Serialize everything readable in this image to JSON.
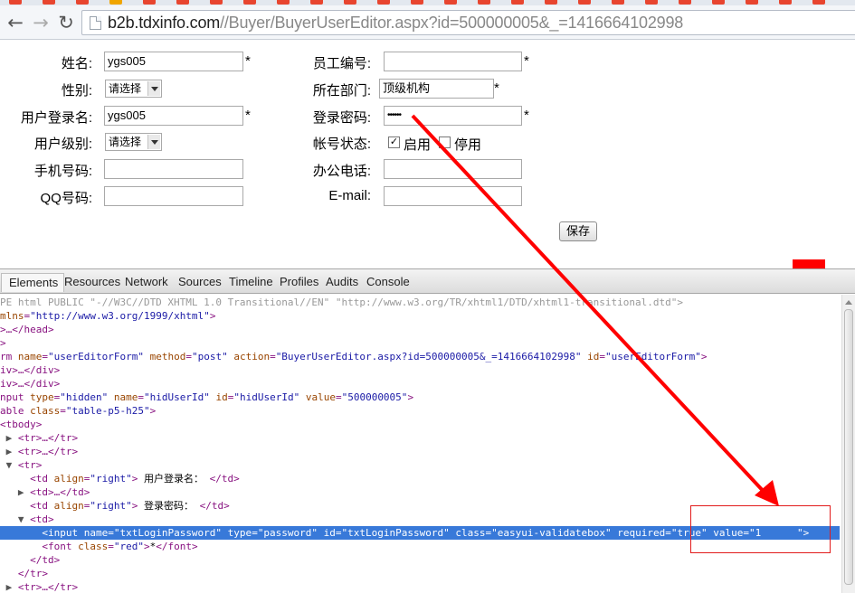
{
  "browser": {
    "url_domain": "b2b.tdxinfo.com",
    "url_path": "//Buyer/BuyerUserEditor.aspx?id=500000005&_=1416664102998",
    "back_icon": "back-arrow-icon",
    "forward_icon": "forward-arrow-icon",
    "reload_icon": "reload-icon",
    "tab_colors": [
      "#e8452f",
      "#e8452f",
      "#e8452f",
      "#f0a500",
      "#e8452f",
      "#e8452f",
      "#e8452f",
      "#e8452f",
      "#e8452f",
      "#e8452f",
      "#e8452f",
      "#e8452f",
      "#e8452f",
      "#e8452f",
      "#e8452f",
      "#e8452f",
      "#e8452f",
      "#e8452f",
      "#e8452f",
      "#e8452f",
      "#e8452f",
      "#e8452f",
      "#e8452f",
      "#e8452f",
      "#e8452f"
    ]
  },
  "form": {
    "name_label": "姓名:",
    "name_value": "ygs005",
    "employee_no_label": "员工编号:",
    "employee_no_value": "",
    "gender_label": "性别:",
    "gender_value": "请选择",
    "department_label": "所在部门:",
    "department_value": "顶级机构",
    "login_name_label": "用户登录名:",
    "login_name_value": "ygs005",
    "password_label": "登录密码:",
    "password_value": "••••••",
    "user_level_label": "用户级别:",
    "user_level_value": "请选择",
    "account_status_label": "帐号状态:",
    "enabled_label": "启用",
    "enabled_checked": true,
    "disabled_label": "停用",
    "disabled_checked": false,
    "mobile_label": "手机号码:",
    "mobile_value": "",
    "office_phone_label": "办公电话:",
    "office_phone_value": "",
    "qq_label": "QQ号码:",
    "qq_value": "",
    "email_label": "E-mail:",
    "email_value": "",
    "required_mark": "*",
    "save_label": "保存"
  },
  "devtools": {
    "tabs": [
      "Elements",
      "Resources",
      "Network",
      "Sources",
      "Timeline",
      "Profiles",
      "Audits",
      "Console"
    ],
    "active_tab": "Elements",
    "selected_line_index": 17,
    "lines": [
      [
        [
          "dim",
          "PE html PUBLIC \"-//W3C//DTD XHTML 1.0 Transitional//EN\" \"http://www.w3.org/TR/xhtml1/DTD/xhtml1-transitional.dtd\">"
        ]
      ],
      [
        [
          "an",
          "mlns"
        ],
        [
          "tag",
          "="
        ],
        [
          "av",
          "\"http://www.w3.org/1999/xhtml\""
        ],
        [
          "tag",
          ">"
        ]
      ],
      [
        [
          "tag",
          ">…</head>"
        ]
      ],
      [
        [
          "tag",
          ">"
        ]
      ],
      [
        [
          "tag",
          "rm "
        ],
        [
          "an",
          "name"
        ],
        [
          "tag",
          "="
        ],
        [
          "av",
          "\"userEditorForm\""
        ],
        [
          "an",
          " method"
        ],
        [
          "tag",
          "="
        ],
        [
          "av",
          "\"post\""
        ],
        [
          "an",
          " action"
        ],
        [
          "tag",
          "="
        ],
        [
          "av",
          "\"BuyerUserEditor.aspx?id=500000005&_=1416664102998\""
        ],
        [
          "an",
          " id"
        ],
        [
          "tag",
          "="
        ],
        [
          "av",
          "\"userEditorForm\""
        ],
        [
          "tag",
          ">"
        ]
      ],
      [
        [
          "tag",
          "iv>…</div>"
        ]
      ],
      [
        [
          "tag",
          "iv>…</div>"
        ]
      ],
      [
        [
          "tag",
          "nput "
        ],
        [
          "an",
          "type"
        ],
        [
          "tag",
          "="
        ],
        [
          "av",
          "\"hidden\""
        ],
        [
          "an",
          " name"
        ],
        [
          "tag",
          "="
        ],
        [
          "av",
          "\"hidUserId\""
        ],
        [
          "an",
          " id"
        ],
        [
          "tag",
          "="
        ],
        [
          "av",
          "\"hidUserId\""
        ],
        [
          "an",
          " value"
        ],
        [
          "tag",
          "="
        ],
        [
          "av",
          "\"500000005\""
        ],
        [
          "tag",
          ">"
        ]
      ],
      [
        [
          "tag",
          "able "
        ],
        [
          "an",
          "class"
        ],
        [
          "tag",
          "="
        ],
        [
          "av",
          "\"table-p5-h25\""
        ],
        [
          "tag",
          ">"
        ]
      ],
      [
        [
          "tag",
          "<tbody>"
        ]
      ],
      [
        [
          "tri",
          " ▶ "
        ],
        [
          "tag",
          "<tr>…</tr>"
        ]
      ],
      [
        [
          "tri",
          " ▶ "
        ],
        [
          "tag",
          "<tr>…</tr>"
        ]
      ],
      [
        [
          "tri",
          " ▼ "
        ],
        [
          "tag",
          "<tr>"
        ]
      ],
      [
        [
          "tx",
          "     "
        ],
        [
          "tag",
          "<td "
        ],
        [
          "an",
          "align"
        ],
        [
          "tag",
          "="
        ],
        [
          "av",
          "\"right\""
        ],
        [
          "tag",
          ">"
        ],
        [
          "tx",
          " 用户登录名： "
        ],
        [
          "tag",
          "</td>"
        ]
      ],
      [
        [
          "tri",
          "   ▶ "
        ],
        [
          "tag",
          "<td>…</td>"
        ]
      ],
      [
        [
          "tx",
          "     "
        ],
        [
          "tag",
          "<td "
        ],
        [
          "an",
          "align"
        ],
        [
          "tag",
          "="
        ],
        [
          "av",
          "\"right\""
        ],
        [
          "tag",
          ">"
        ],
        [
          "tx",
          " 登录密码： "
        ],
        [
          "tag",
          "</td>"
        ]
      ],
      [
        [
          "tri",
          "   ▼ "
        ],
        [
          "tag",
          "<td>"
        ]
      ],
      [
        [
          "tx",
          "       "
        ],
        [
          "tag",
          "<input "
        ],
        [
          "an",
          "name"
        ],
        [
          "tag",
          "="
        ],
        [
          "av",
          "\"txtLoginPassword\""
        ],
        [
          "an",
          " type"
        ],
        [
          "tag",
          "="
        ],
        [
          "av",
          "\"password\""
        ],
        [
          "an",
          " id"
        ],
        [
          "tag",
          "="
        ],
        [
          "av",
          "\"txtLoginPassword\""
        ],
        [
          "an",
          " class"
        ],
        [
          "tag",
          "="
        ],
        [
          "av",
          "\"easyui-validatebox\""
        ],
        [
          "an",
          " required"
        ],
        [
          "tag",
          "="
        ],
        [
          "av",
          "\"true\""
        ],
        [
          "an",
          " value"
        ],
        [
          "tag",
          "="
        ],
        [
          "av",
          "\"1"
        ],
        [
          "tx",
          "      "
        ],
        [
          "av",
          "\""
        ],
        [
          "tag",
          ">"
        ]
      ],
      [
        [
          "tx",
          "       "
        ],
        [
          "tag",
          "<font "
        ],
        [
          "an",
          "class"
        ],
        [
          "tag",
          "="
        ],
        [
          "av",
          "\"red\""
        ],
        [
          "tag",
          ">"
        ],
        [
          "tx",
          "*"
        ],
        [
          "tag",
          "</font>"
        ]
      ],
      [
        [
          "tx",
          "     "
        ],
        [
          "tag",
          "</td>"
        ]
      ],
      [
        [
          "tx",
          "   "
        ],
        [
          "tag",
          "</tr>"
        ]
      ],
      [
        [
          "tri",
          " ▶ "
        ],
        [
          "tag",
          "<tr>…</tr>"
        ]
      ]
    ]
  },
  "annotation": {
    "arrow_color": "#ff0000",
    "box_color": "#e21b1b",
    "redaction_color": "#ff0000"
  }
}
